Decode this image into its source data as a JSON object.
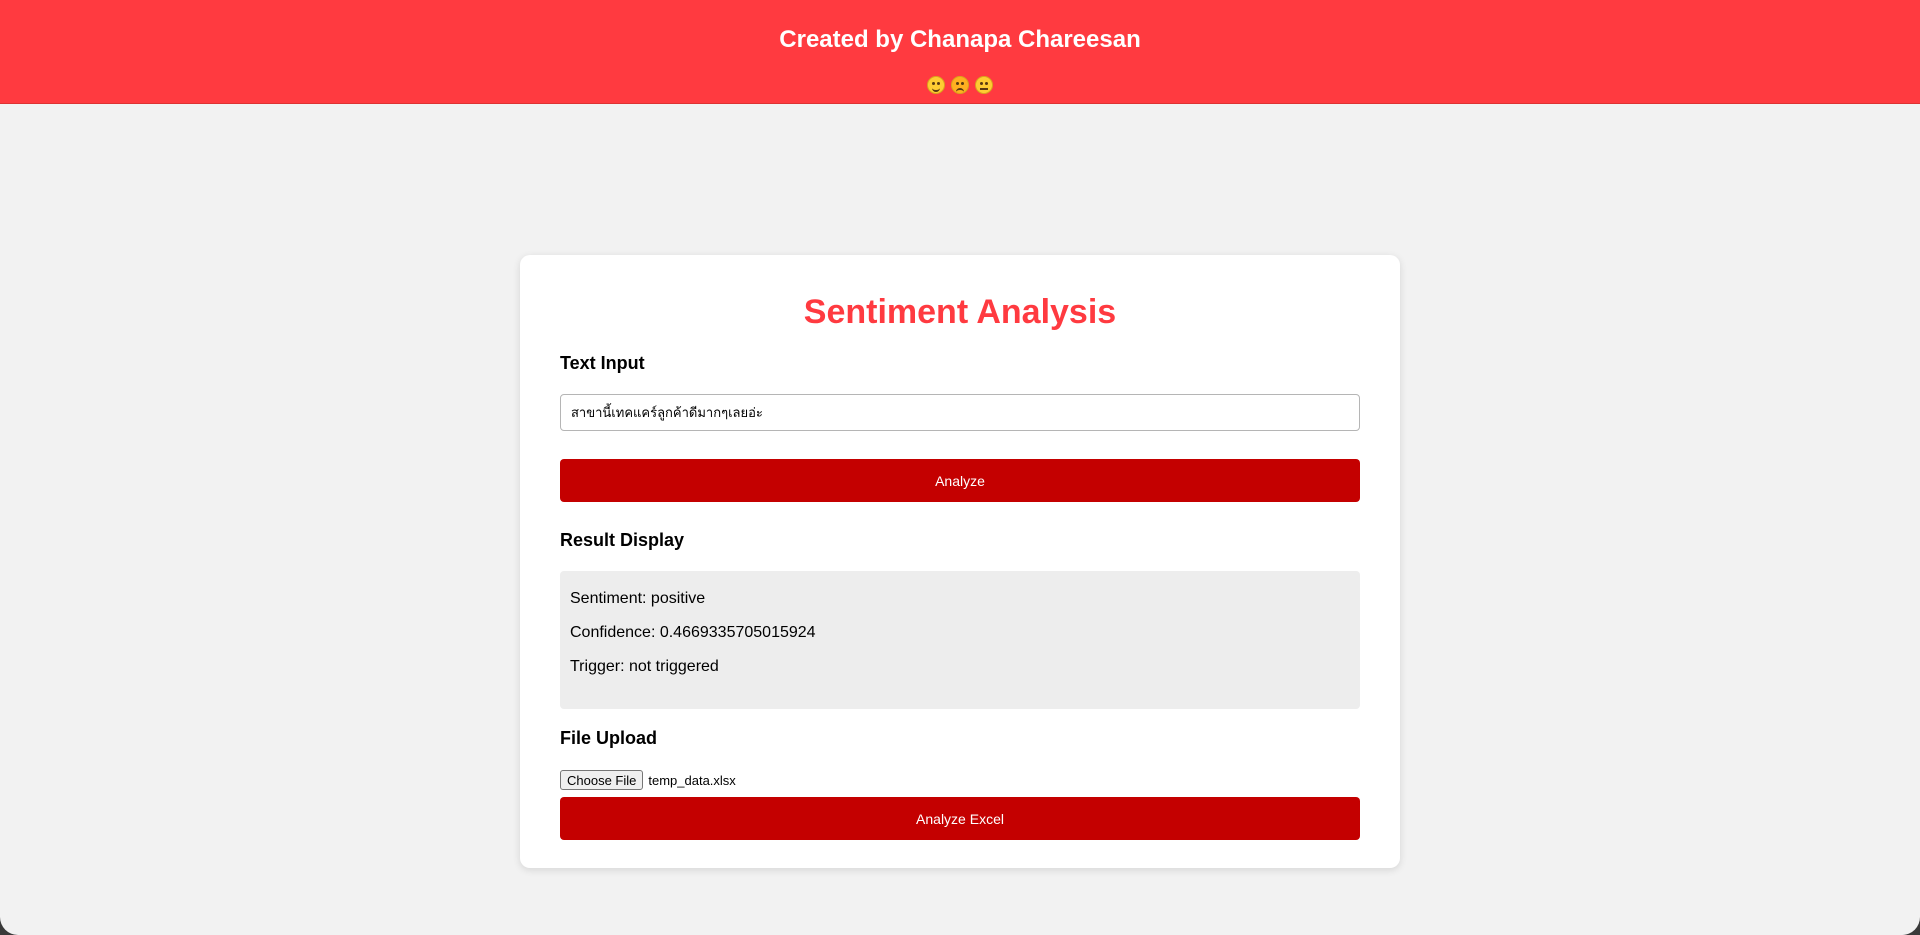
{
  "header": {
    "title": "Created by Chanapa Chareesan",
    "emojis": [
      "smile-emoji-icon",
      "angry-emoji-icon",
      "neutral-emoji-icon"
    ]
  },
  "card": {
    "title": "Sentiment Analysis",
    "text_input": {
      "label": "Text Input",
      "value": "สาขานี้เทคแคร์ลูกค้าดีมากๆเลยอ่ะ"
    },
    "analyze_button": "Analyze",
    "result": {
      "label": "Result Display",
      "sentiment": "Sentiment: positive",
      "confidence": "Confidence: 0.4669335705015924",
      "trigger": "Trigger: not triggered"
    },
    "file_upload": {
      "label": "File Upload",
      "choose_button": "Choose File",
      "file_name": "temp_data.xlsx"
    },
    "analyze_excel_button": "Analyze Excel"
  },
  "colors": {
    "header_bg": "#ff3a40",
    "title_red": "#ff3a40",
    "button_red": "#c40000",
    "page_bg": "#f2f2f2",
    "result_bg": "#ededed"
  }
}
